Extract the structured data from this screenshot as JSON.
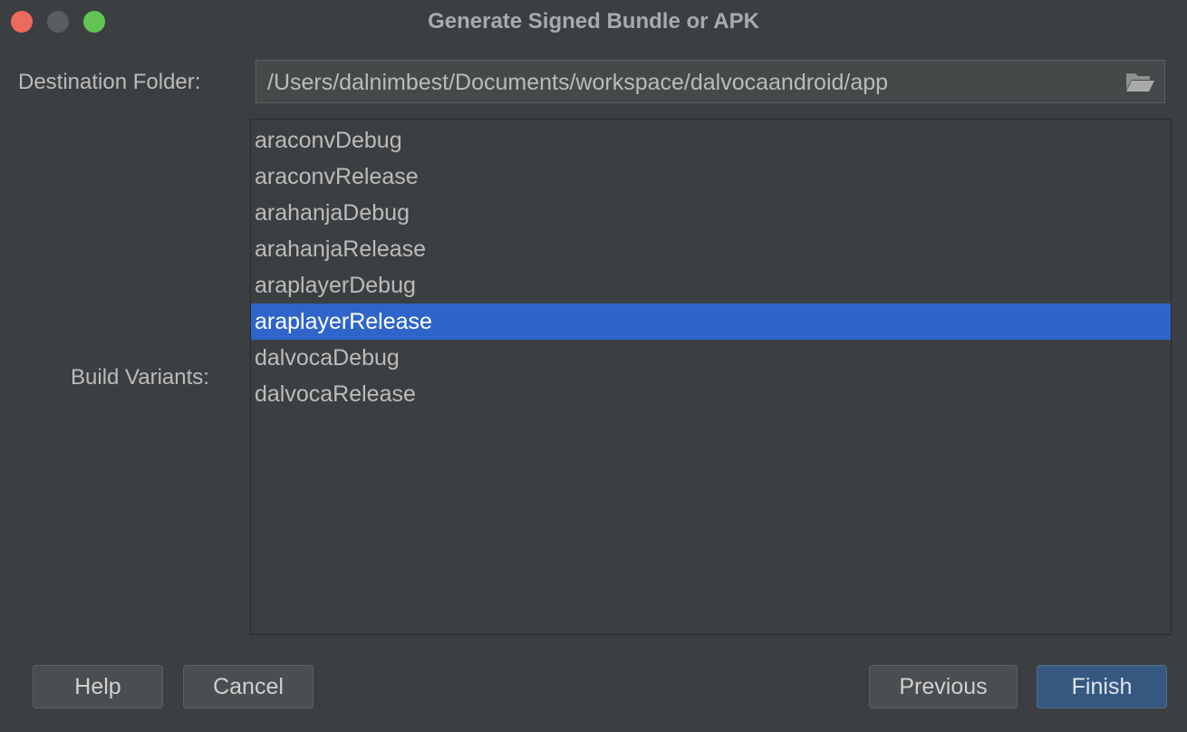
{
  "window": {
    "title": "Generate Signed Bundle or APK"
  },
  "destination": {
    "label": "Destination Folder:",
    "value": "/Users/dalnimbest/Documents/workspace/dalvocaandroid/app",
    "browse_icon": "folder-open-icon"
  },
  "build_variants": {
    "label": "Build Variants:",
    "items": [
      "araconvDebug",
      "araconvRelease",
      "arahanjaDebug",
      "arahanjaRelease",
      "araplayerDebug",
      "araplayerRelease",
      "dalvocaDebug",
      "dalvocaRelease"
    ],
    "selected": "araplayerRelease"
  },
  "buttons": {
    "help": "Help",
    "cancel": "Cancel",
    "previous": "Previous",
    "finish": "Finish"
  },
  "colors": {
    "background": "#3c3f41",
    "selection": "#2f65ca",
    "primary_button": "#365880",
    "close": "#ec6a5e",
    "zoom": "#61c454"
  }
}
